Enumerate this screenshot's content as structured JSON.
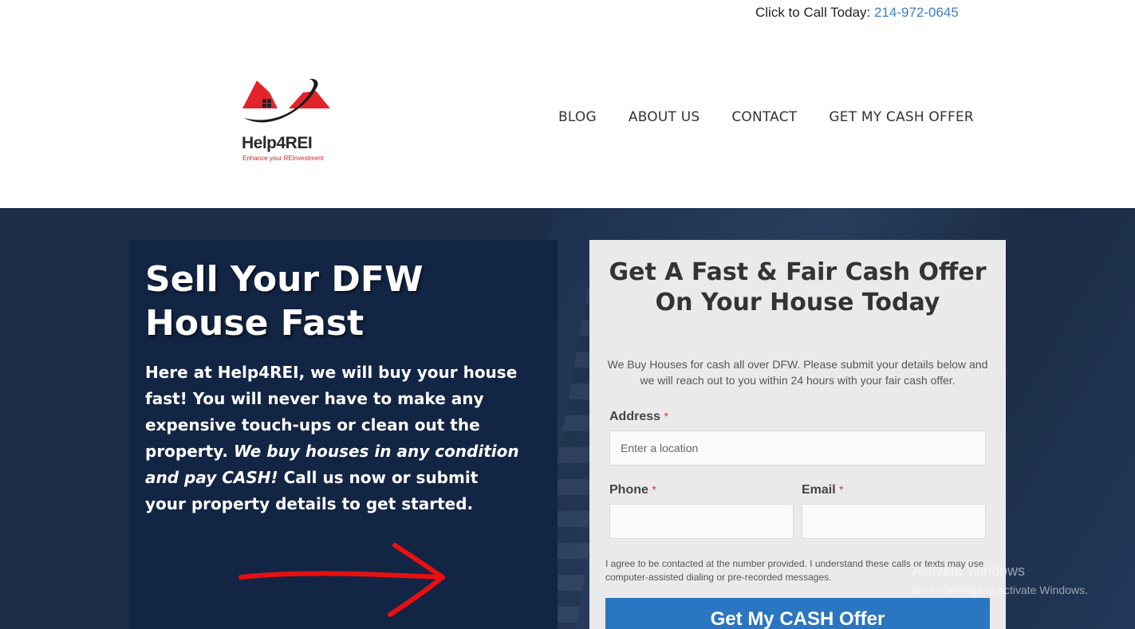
{
  "callbar": {
    "label": "Click to Call Today: ",
    "phone": "214-972-0645"
  },
  "logo": {
    "name": "Help4REI",
    "tagline": "Enhance your REInvestment"
  },
  "nav": {
    "items": [
      "BLOG",
      "ABOUT US",
      "CONTACT",
      "GET MY CASH OFFER"
    ]
  },
  "hero": {
    "title": "Sell Your DFW House Fast",
    "text_part1": "Here at Help4REI, we will buy your house fast! You will never have to make any expensive touch-ups or clean out the property. ",
    "text_emphasis": "We buy houses in any condition and pay CASH!",
    "text_part2": " Call us now or submit your property details to get started."
  },
  "form": {
    "title": "Get A Fast & Fair Cash Offer On Your House Today",
    "subtitle": "We Buy Houses for cash all over DFW. Please submit your details below and we will reach out to you within 24 hours with your fair cash offer.",
    "address_label": "Address",
    "address_placeholder": "Enter a location",
    "phone_label": "Phone",
    "email_label": "Email",
    "required_mark": "*",
    "consent": "I agree to be contacted at the number provided. I understand these calls or texts may use computer-assisted dialing or pre-recorded messages.",
    "submit_label": "Get My CASH Offer"
  },
  "watermark": {
    "line1": "Activate Windows",
    "line2": "Go to Settings to activate Windows."
  },
  "colors": {
    "hero_bg": "#1c2e4a",
    "hero_panel": "#132544",
    "button": "#2a76c0",
    "link": "#3f7fc4",
    "logo_red": "#e0242a"
  }
}
